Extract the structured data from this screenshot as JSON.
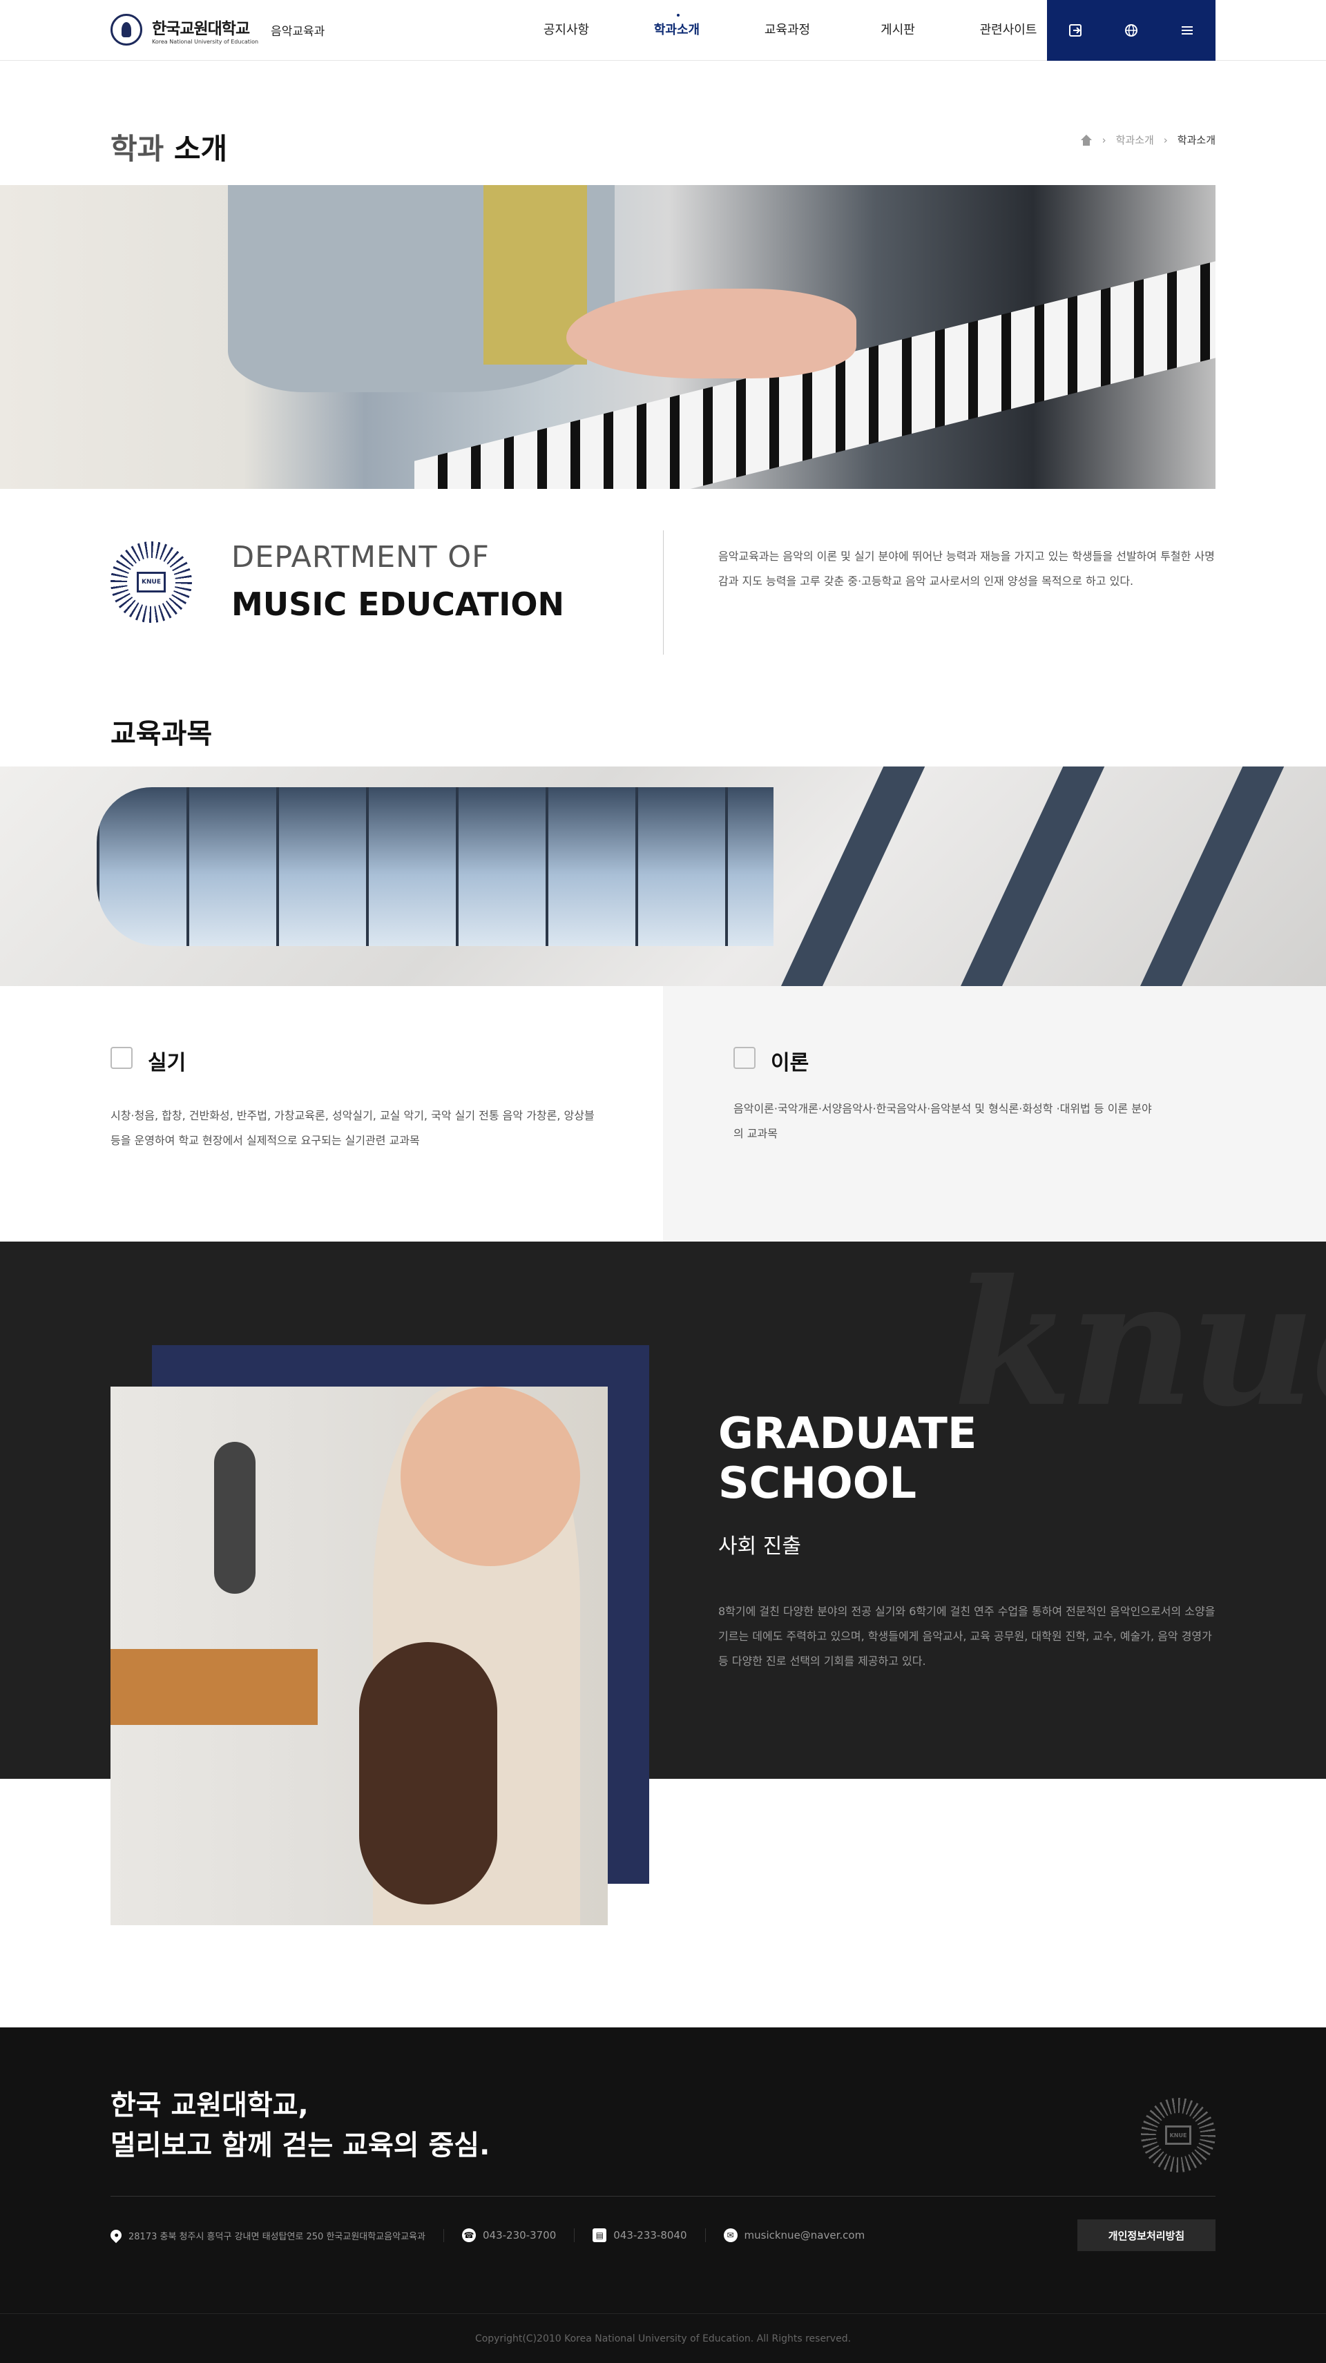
{
  "header": {
    "logo_name": "한국교원대학교",
    "logo_eng": "Korea National University of Education",
    "dept": "음악교육과",
    "nav": [
      "공지사항",
      "학과소개",
      "교육과정",
      "게시판",
      "관련사이트"
    ],
    "active_nav": "학과소개",
    "util_icons": [
      "logout-icon",
      "globe-icon",
      "menu-icon"
    ],
    "accent_color": "#0c2469"
  },
  "title": {
    "light": "학과",
    "bold": "소개"
  },
  "breadcrumb": [
    "학과소개",
    "학과소개"
  ],
  "department": {
    "emblem_label": "KNUE",
    "line1": "DEPARTMENT OF",
    "line2": "MUSIC EDUCATION",
    "desc": "음악교육과는 음악의 이론 및 실기 분야에 뛰어난 능력과 재능을 가지고 있는 학생들을 선발하여 투철한 사명감과 지도 능력을 고루 갖춘 중·고등학교 음악 교사로서의 인재 양성을 목적으로 하고 있다."
  },
  "education": {
    "title": "교육과목",
    "practical": {
      "title": "실기",
      "desc": "시창·청음, 합창, 건반화성, 반주법, 가창교육론, 성악실기, 교실 악기, 국악 실기 전통 음악 가창론, 앙상블 등을 운영하여 학교 현장에서 실제적으로 요구되는 실기관련 교과목"
    },
    "theory": {
      "title": "이론",
      "desc": "음악이론·국악개론·서양음악사·한국음악사·음악분석 및 형식론·화성학 ·대위법 등 이론 분야의 교과목"
    }
  },
  "graduate": {
    "watermark": "knue",
    "title_line1": "GRADUATE",
    "title_line2": "SCHOOL",
    "subtitle": "사회 진출",
    "desc": "8학기에 걸친 다양한 분야의 전공 실기와 6학기에 걸친 연주 수업을 통하여 전문적인 음악인으로서의 소양을 기르는 데에도 주력하고 있으며, 학생들에게 음악교사, 교육 공무원, 대학원 진학, 교수, 예술가, 음악 경영가 등 다양한 진로 선택의 기회를 제공하고 있다."
  },
  "footer": {
    "slogan_line1": "한국 교원대학교,",
    "slogan_line2": "멀리보고 함께 걷는 교육의 중심.",
    "address": "28173 충북 청주시 흥덕구 강내면 태성탑연로 250 한국교원대학교음악교육과",
    "phone": "043-230-3700",
    "fax": "043-233-8040",
    "email": "musicknue@naver.com",
    "privacy": "개인정보처리방침",
    "copyright": "Copyright(C)2010 Korea National University of Education. All Rights reserved."
  }
}
